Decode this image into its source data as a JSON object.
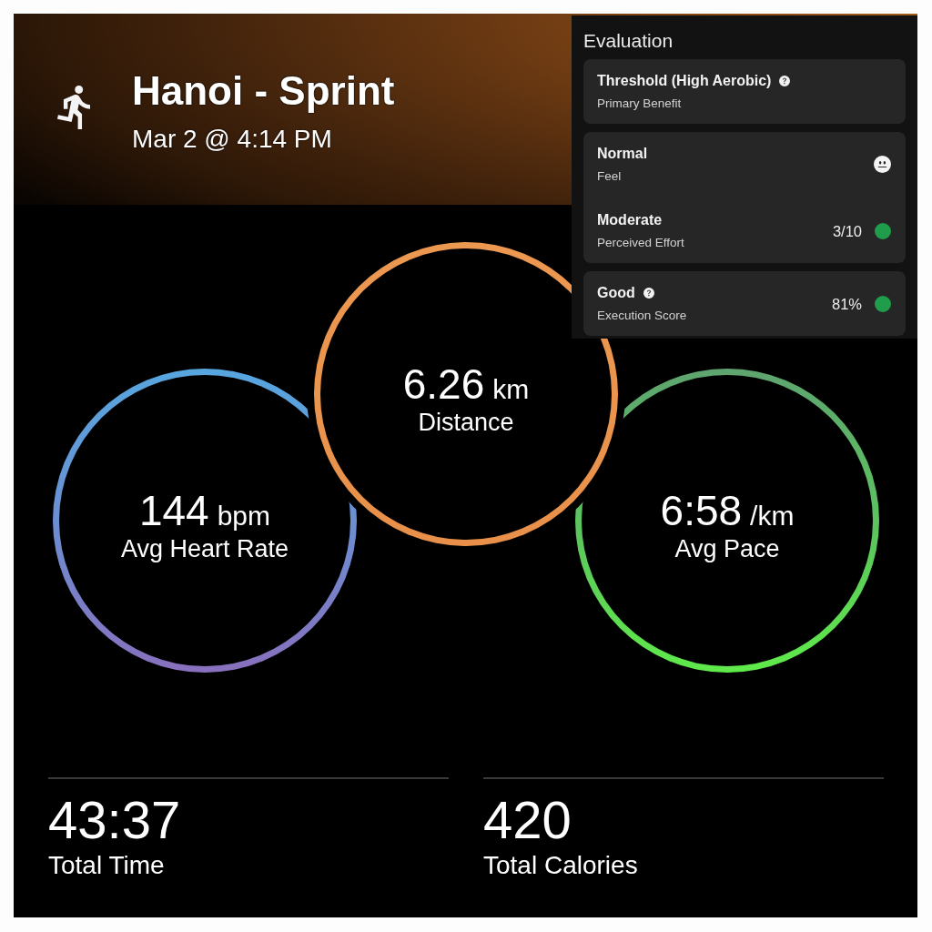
{
  "activity": {
    "title": "Hanoi - Sprint",
    "date": "Mar 2 @ 4:14 PM"
  },
  "evaluation": {
    "title": "Evaluation",
    "cards": [
      {
        "rows": [
          {
            "kind": "plain",
            "value": "Threshold (High Aerobic)",
            "label": "Primary Benefit",
            "help": true
          }
        ]
      },
      {
        "rows": [
          {
            "kind": "face",
            "value": "Normal",
            "label": "Feel",
            "help": false
          },
          {
            "kind": "rating",
            "value": "Moderate",
            "label": "Perceived Effort",
            "help": false,
            "reading": "3/10",
            "color": "#1f9d4a"
          }
        ]
      },
      {
        "rows": [
          {
            "kind": "rating",
            "value": "Good",
            "label": "Execution Score",
            "help": true,
            "reading": "81%",
            "color": "#1f9d4a"
          }
        ]
      }
    ]
  },
  "metrics": [
    {
      "value": "6.26",
      "unit": "km",
      "label": "Distance"
    },
    {
      "value": "144",
      "unit": "bpm",
      "label": "Avg Heart Rate"
    },
    {
      "value": "6:58",
      "unit": "/km",
      "label": "Avg Pace"
    }
  ],
  "totals": [
    {
      "value": "43:37",
      "label": "Total Time"
    },
    {
      "value": "420",
      "label": "Total Calories"
    }
  ]
}
